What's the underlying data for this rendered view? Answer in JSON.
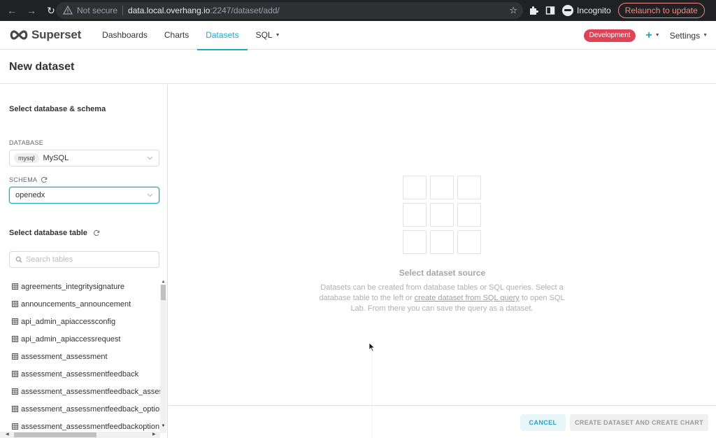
{
  "browser": {
    "not_secure": "Not secure",
    "url_host": "data.local.overhang.io",
    "url_path": ":2247/dataset/add/",
    "profile_label": "Incognito",
    "relaunch_label": "Relaunch to update"
  },
  "header": {
    "brand": "Superset",
    "menu": [
      {
        "label": "Dashboards"
      },
      {
        "label": "Charts"
      },
      {
        "label": "Datasets"
      },
      {
        "label": "SQL"
      }
    ],
    "environment_badge": "Development",
    "settings_label": "Settings"
  },
  "page": {
    "title": "New dataset"
  },
  "left_panel": {
    "db_schema_title": "Select database & schema",
    "database_label": "DATABASE",
    "database_tag": "mysql",
    "database_value": "MySQL",
    "schema_label": "SCHEMA",
    "schema_value": "openedx",
    "table_section_title": "Select database table",
    "search_placeholder": "Search tables",
    "tables": [
      "agreements_integritysignature",
      "announcements_announcement",
      "api_admin_apiaccessconfig",
      "api_admin_apiaccessrequest",
      "assessment_assessment",
      "assessment_assessmentfeedback",
      "assessment_assessmentfeedback_assessments",
      "assessment_assessmentfeedback_options",
      "assessment_assessmentfeedbackoption"
    ]
  },
  "main": {
    "empty_title": "Select dataset source",
    "empty_desc_1": "Datasets can be created from database tables or SQL queries. Select a database table to the left or ",
    "empty_desc_link": "create dataset from SQL query",
    "empty_desc_2": " to open SQL Lab. From there you can save the query as a dataset."
  },
  "footer": {
    "cancel_label": "CANCEL",
    "create_label": "CREATE DATASET AND CREATE CHART"
  },
  "colors": {
    "accent": "#20a7c9",
    "badge": "#e04355"
  }
}
